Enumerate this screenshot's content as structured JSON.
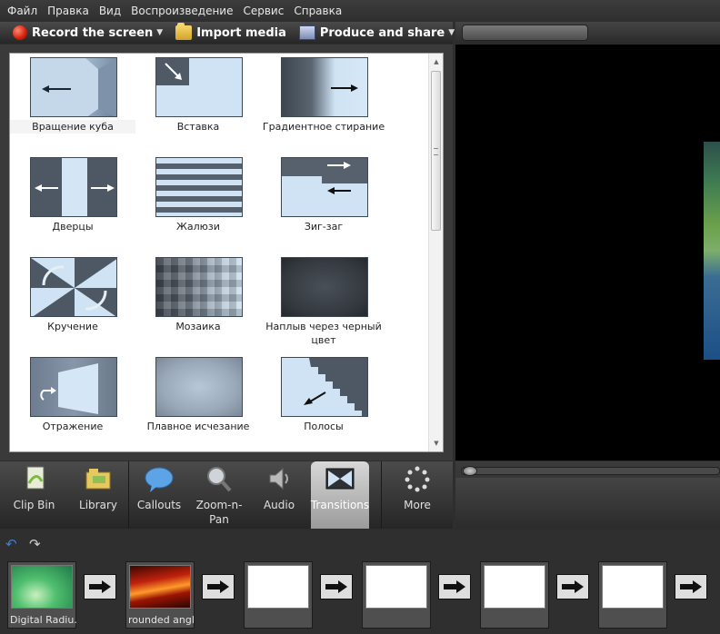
{
  "menubar": {
    "items": [
      "Файл",
      "Правка",
      "Вид",
      "Воспроизведение",
      "Сервис",
      "Справка"
    ]
  },
  "toolbar": {
    "record_label": "Record the screen",
    "import_label": "Import media",
    "produce_label": "Produce and share"
  },
  "transitions": {
    "items": [
      {
        "label": "Вращение куба",
        "icon": "cube-rotation-thumbnail",
        "selected": true
      },
      {
        "label": "Вставка",
        "icon": "insert-thumbnail"
      },
      {
        "label": "Градиентное стирание",
        "icon": "gradient-wipe-thumbnail"
      },
      {
        "label": "Дверцы",
        "icon": "doors-thumbnail"
      },
      {
        "label": "Жалюзи",
        "icon": "blinds-thumbnail"
      },
      {
        "label": "Зиг-заг",
        "icon": "zigzag-thumbnail"
      },
      {
        "label": "Кручение",
        "icon": "twist-thumbnail"
      },
      {
        "label": "Мозаика",
        "icon": "mosaic-thumbnail"
      },
      {
        "label": "Наплыв через черный цвет",
        "icon": "fade-through-black-thumbnail"
      },
      {
        "label": "Отражение",
        "icon": "reflection-thumbnail"
      },
      {
        "label": "Плавное исчезание",
        "icon": "fade-thumbnail"
      },
      {
        "label": "Полосы",
        "icon": "stripes-thumbnail"
      }
    ]
  },
  "tabs": {
    "items": [
      {
        "label": "Clip Bin",
        "icon": "clip-bin-icon"
      },
      {
        "label": "Library",
        "icon": "library-icon"
      },
      {
        "label": "Callouts",
        "icon": "callouts-icon"
      },
      {
        "label": "Zoom-n-Pan",
        "icon": "zoom-icon"
      },
      {
        "label": "Audio",
        "icon": "audio-icon"
      },
      {
        "label": "Transitions",
        "icon": "transitions-icon",
        "active": true
      },
      {
        "label": "More",
        "icon": "more-icon"
      }
    ]
  },
  "timeline": {
    "clips": [
      {
        "label": "Digital Radiu..."
      },
      {
        "label": "rounded angl..."
      },
      {
        "label": ""
      },
      {
        "label": ""
      },
      {
        "label": ""
      },
      {
        "label": ""
      }
    ]
  },
  "colors": {
    "accent": "#3d7fd6",
    "panel_bg": "#2e2e2e",
    "record": "#d21e0a"
  }
}
